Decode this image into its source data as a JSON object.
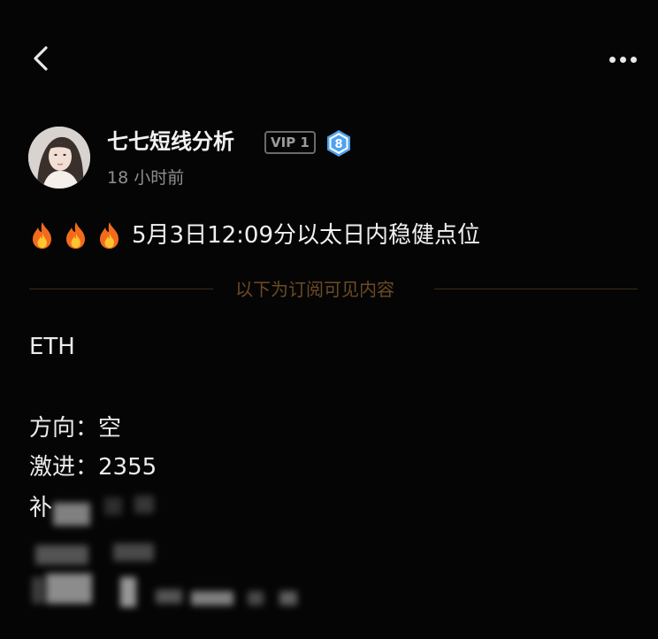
{
  "topbar": {
    "back_icon": "chevron-left-icon",
    "more_icon": "more-dots-icon"
  },
  "author": {
    "name": "七七短线分析",
    "vip_label": "VIP 1",
    "level": "8",
    "time": "18 小时前",
    "level_color": "#4ea3f0"
  },
  "post": {
    "headline_icon": "fire-icon",
    "headline_icon_count": 3,
    "headline": "5月3日12:09分以太日内稳健点位",
    "divider_text": "以下为订阅可见内容",
    "accent_color": "#6c4a24",
    "lines": {
      "symbol": "ETH",
      "direction": "方向：空",
      "aggressive": "激进：2355",
      "partial": "补"
    },
    "hidden_note": "remaining content blurred / subscriber-only"
  }
}
